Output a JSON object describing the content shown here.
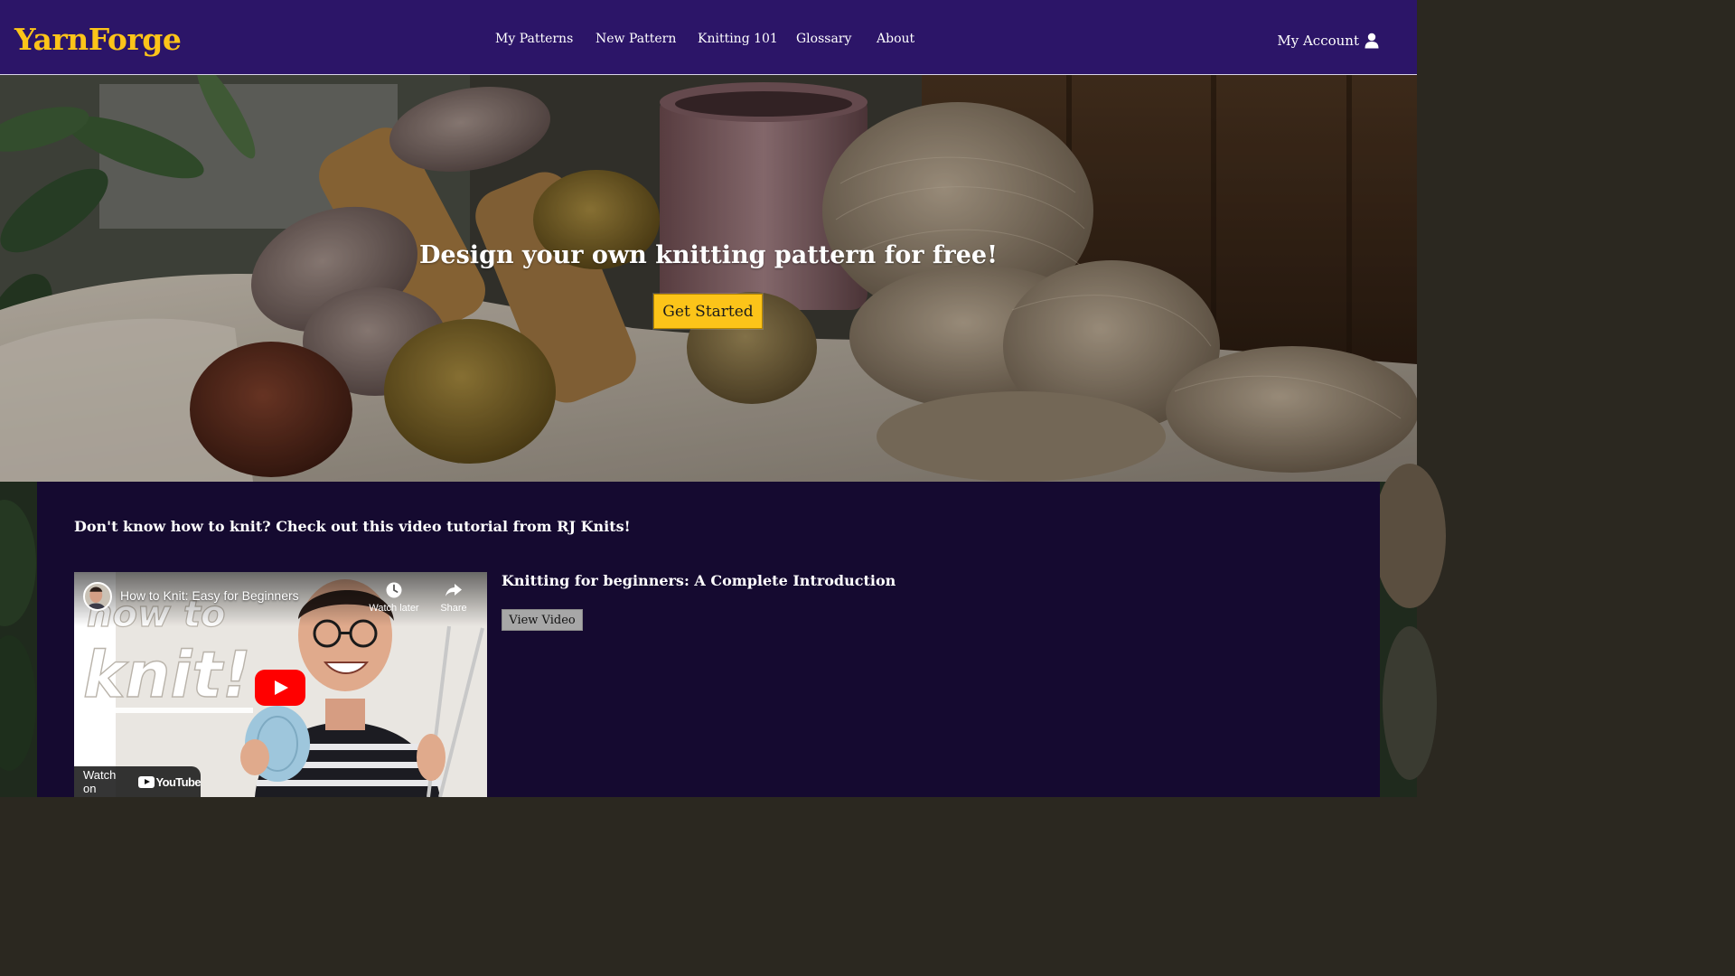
{
  "brand": {
    "name": "YarnForge",
    "color": "#fcc419"
  },
  "nav": {
    "items": [
      {
        "label": "My Patterns"
      },
      {
        "label": "New Pattern"
      },
      {
        "label": "Knitting 101"
      },
      {
        "label": "Glossary"
      },
      {
        "label": "About"
      }
    ],
    "account_label": "My Account",
    "account_icon": "user-icon"
  },
  "hero": {
    "title": "Design your own knitting pattern for free!",
    "cta_label": "Get Started"
  },
  "tutorial": {
    "heading": "Don't know how to knit? Check out this video tutorial from RJ Knits!",
    "video": {
      "embed_title": "How to Knit: Easy for Beginners",
      "thumbnail_text_line1": "how to",
      "thumbnail_text_line2": "knit!",
      "watch_later_label": "Watch later",
      "share_label": "Share",
      "watch_on_label": "Watch on",
      "platform_name": "YouTube"
    },
    "video_title": "Knitting for beginners: A Complete Introduction",
    "view_button_label": "View Video"
  },
  "colors": {
    "navbar": "#2c1568",
    "panel": "#150a30",
    "accent": "#fcc419",
    "youtube_red": "#ff0000"
  }
}
